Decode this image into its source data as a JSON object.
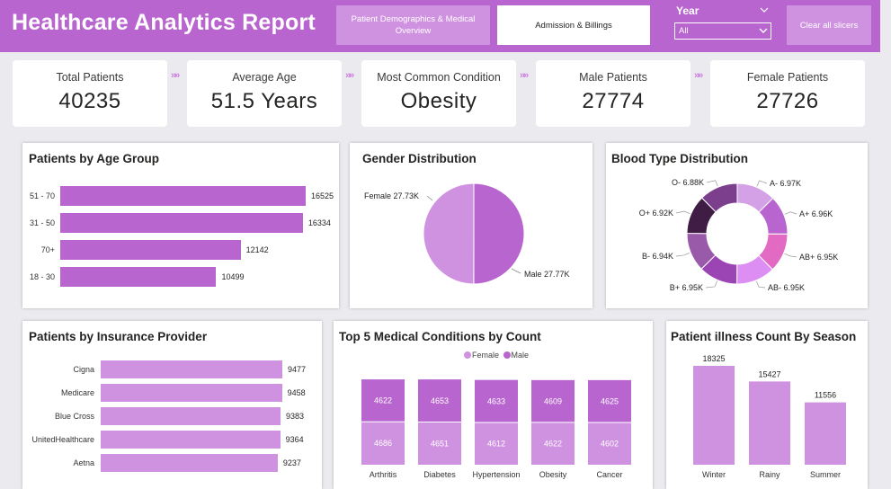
{
  "header": {
    "title": "Healthcare Analytics Report",
    "nav_demographics": "Patient Demographics & Medical Overview",
    "nav_admission": "Admission & Billings",
    "year_slicer_title": "Year",
    "year_slicer_value": "All",
    "clear_slicers": "Clear all slicers"
  },
  "kpis": [
    {
      "label": "Total Patients",
      "value": "40235"
    },
    {
      "label": "Average Age",
      "value": "51.5 Years"
    },
    {
      "label": "Most Common Condition",
      "value": "Obesity"
    },
    {
      "label": "Male Patients",
      "value": "27774"
    },
    {
      "label": "Female Patients",
      "value": "27726"
    }
  ],
  "kpi_arrow": "»»",
  "colors": {
    "header": "#b865cf",
    "bar_primary": "#b865cf",
    "bar_light": "#cf92e0",
    "female": "#cf92e0",
    "male": "#b865cf",
    "arrow": "#cc7fe0"
  },
  "chart_data": [
    {
      "id": "age_group",
      "type": "bar",
      "orientation": "horizontal",
      "title": "Patients by Age Group",
      "categories": [
        "51 - 70",
        "31 - 50",
        "70+",
        "18 - 30"
      ],
      "values": [
        16525,
        16334,
        12142,
        10499
      ],
      "value_labels": [
        "16525",
        "16334",
        "12142",
        "10499"
      ]
    },
    {
      "id": "gender",
      "type": "pie",
      "title": "Gender Distribution",
      "labels": [
        "Female",
        "Male"
      ],
      "values": [
        27.73,
        27.77
      ],
      "value_labels": [
        "Female 27.73K",
        "Male 27.77K"
      ],
      "colors": [
        "#cf92e0",
        "#b865cf"
      ]
    },
    {
      "id": "blood_type",
      "type": "pie",
      "style": "donut",
      "title": "Blood Type Distribution",
      "labels": [
        "A-",
        "A+",
        "AB+",
        "AB-",
        "B+",
        "B-",
        "O+",
        "O-"
      ],
      "values": [
        6.97,
        6.96,
        6.95,
        6.95,
        6.95,
        6.94,
        6.92,
        6.88
      ],
      "value_labels": [
        "A- 6.97K",
        "A+ 6.96K",
        "AB+ 6.95K",
        "AB- 6.95K",
        "B+ 6.95K",
        "B- 6.94K",
        "O+ 6.92K",
        "O- 6.88K"
      ],
      "colors": [
        "#d4a0e6",
        "#b865cf",
        "#e36ac2",
        "#dd8ef2",
        "#9b44b4",
        "#9a5aaa",
        "#3f1d45",
        "#7c3f8e"
      ]
    },
    {
      "id": "insurance",
      "type": "bar",
      "orientation": "horizontal",
      "title": "Patients by Insurance Provider",
      "categories": [
        "Cigna",
        "Medicare",
        "Blue Cross",
        "UnitedHealthcare",
        "Aetna"
      ],
      "values": [
        9477,
        9458,
        9383,
        9364,
        9237
      ],
      "value_labels": [
        "9477",
        "9458",
        "9383",
        "9364",
        "9237"
      ]
    },
    {
      "id": "conditions",
      "type": "bar",
      "stacked": true,
      "title": "Top 5 Medical Conditions by Count",
      "categories": [
        "Arthritis",
        "Diabetes",
        "Hypertension",
        "Obesity",
        "Cancer"
      ],
      "legend": [
        "Female",
        "Male"
      ],
      "series": [
        {
          "name": "Female",
          "values": [
            4686,
            4651,
            4612,
            4622,
            4602
          ],
          "labels": [
            "4686",
            "4651",
            "4612",
            "4622",
            "4602"
          ]
        },
        {
          "name": "Male",
          "values": [
            4622,
            4653,
            4633,
            4609,
            4625
          ],
          "labels": [
            "4622",
            "4653",
            "4633",
            "4609",
            "4625"
          ]
        }
      ]
    },
    {
      "id": "season",
      "type": "bar",
      "title": "Patient illness Count By Season",
      "categories": [
        "Winter",
        "Rainy",
        "Summer"
      ],
      "values": [
        18325,
        15427,
        11556
      ],
      "value_labels": [
        "18325",
        "15427",
        "11556"
      ]
    }
  ]
}
